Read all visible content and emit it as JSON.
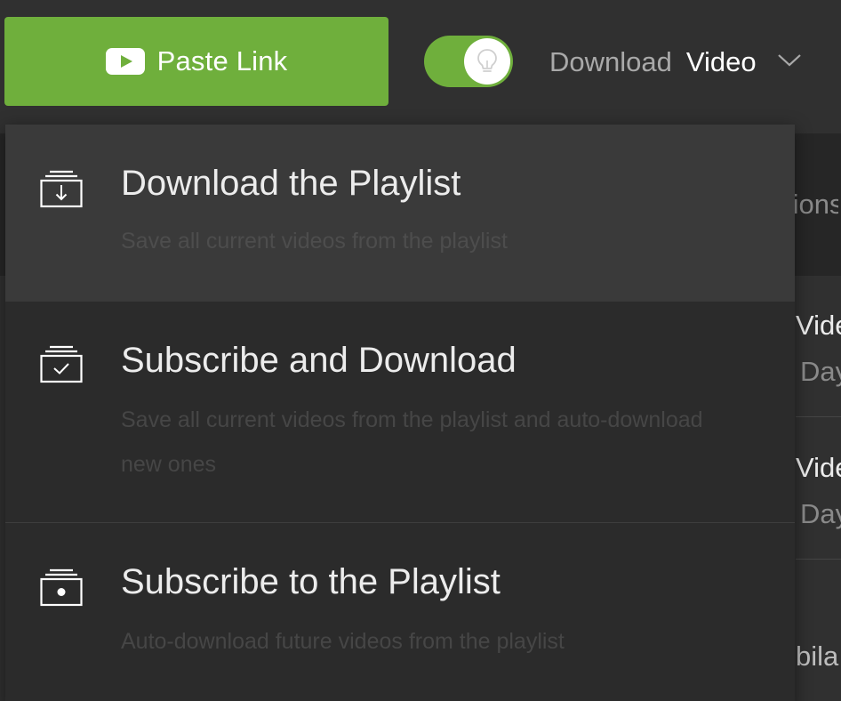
{
  "toolbar": {
    "paste_label": "Paste Link",
    "download_prefix": "Download",
    "download_value": "Video",
    "accent_color": "#6faf3c"
  },
  "menu": {
    "items": [
      {
        "title": "Download the Playlist",
        "description": "Save all current videos from the playlist",
        "icon": "playlist-download-icon"
      },
      {
        "title": "Subscribe and Download",
        "description": "Save all current videos from the playlist and auto-download new ones",
        "icon": "playlist-check-icon"
      },
      {
        "title": "Subscribe to the Playlist",
        "description": "Auto-download future videos from the playlist",
        "icon": "playlist-subscribe-icon"
      }
    ]
  },
  "background": {
    "header_fragment": "tions",
    "rows": [
      {
        "title_fragment": "Video",
        "meta_fragment": "Day"
      },
      {
        "title_fragment": "Video",
        "meta_fragment": "Day"
      },
      {
        "title_fragment": "bila"
      }
    ]
  }
}
